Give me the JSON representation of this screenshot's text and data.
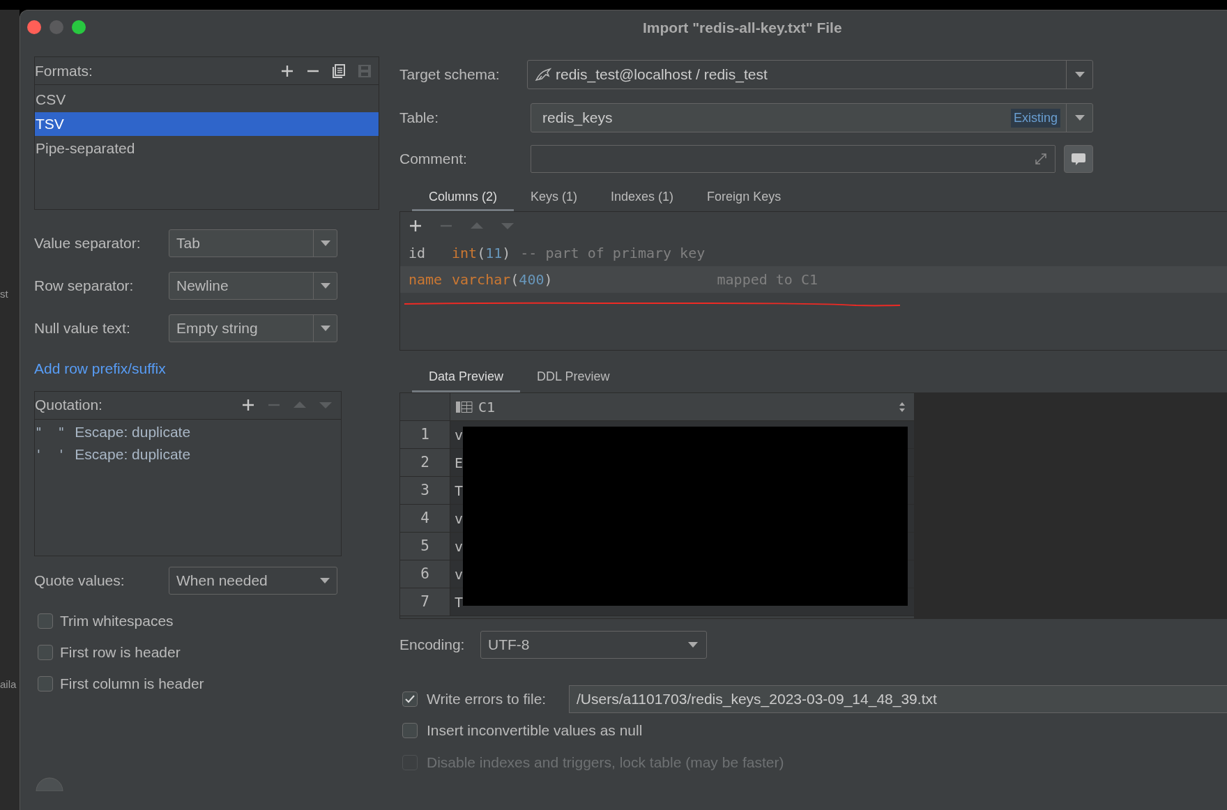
{
  "background_fragments": [
    "st",
    "aila"
  ],
  "window": {
    "title": "Import \"redis-all-key.txt\" File"
  },
  "formats": {
    "label": "Formats:",
    "toolbar": [
      {
        "kind": "add",
        "disabled": false
      },
      {
        "kind": "remove",
        "disabled": false
      },
      {
        "kind": "copy",
        "disabled": false
      },
      {
        "kind": "save",
        "disabled": true
      }
    ],
    "items": [
      {
        "label": "CSV",
        "selected": false
      },
      {
        "label": "TSV",
        "selected": true
      },
      {
        "label": "Pipe-separated",
        "selected": false
      }
    ]
  },
  "separators": [
    {
      "label": "Value separator:",
      "value": "Tab"
    },
    {
      "label": "Row separator:",
      "value": "Newline"
    },
    {
      "label": "Null value text:",
      "value": "Empty string"
    }
  ],
  "add_row_link": "Add row prefix/suffix",
  "quotation": {
    "label": "Quotation:",
    "toolbar": [
      {
        "kind": "add",
        "disabled": false
      },
      {
        "kind": "remove",
        "disabled": true
      },
      {
        "kind": "up",
        "disabled": true
      },
      {
        "kind": "down",
        "disabled": true
      }
    ],
    "items": [
      {
        "quote": "\"  \"",
        "escape": "Escape: duplicate"
      },
      {
        "quote": "'  '",
        "escape": "Escape: duplicate"
      }
    ]
  },
  "quote_values": {
    "label": "Quote values:",
    "value": "When needed"
  },
  "checkboxes": [
    {
      "label": "Trim whitespaces",
      "checked": false
    },
    {
      "label": "First row is header",
      "checked": false
    },
    {
      "label": "First column is header",
      "checked": false
    }
  ],
  "target_schema": {
    "label": "Target schema:",
    "value": "redis_test@localhost / redis_test"
  },
  "table": {
    "label": "Table:",
    "value": "redis_keys",
    "badge": "Existing"
  },
  "comment": {
    "label": "Comment:"
  },
  "column_tabs": [
    {
      "label": "Columns (2)",
      "selected": true
    },
    {
      "label": "Keys (1)",
      "selected": false
    },
    {
      "label": "Indexes (1)",
      "selected": false
    },
    {
      "label": "Foreign Keys",
      "selected": false
    }
  ],
  "columns_toolbar": [
    {
      "kind": "add",
      "disabled": false
    },
    {
      "kind": "remove",
      "disabled": true
    },
    {
      "kind": "up",
      "disabled": true
    },
    {
      "kind": "down",
      "disabled": true
    }
  ],
  "columns": [
    {
      "name": "id",
      "type_parts": [
        "int",
        "(",
        "11",
        ")"
      ],
      "note": "-- part of primary key",
      "mapped": false
    },
    {
      "name": "name",
      "type_parts": [
        "varchar",
        "(",
        "400",
        ")"
      ],
      "note": "mapped to C1",
      "mapped": true
    }
  ],
  "preview_tabs": [
    {
      "label": "Data Preview",
      "selected": true
    },
    {
      "label": "DDL Preview",
      "selected": false
    }
  ],
  "preview": {
    "column": "C1",
    "rows": [
      {
        "number": "1",
        "value": "v"
      },
      {
        "number": "2",
        "value": "E"
      },
      {
        "number": "3",
        "value": "T"
      },
      {
        "number": "4",
        "value": "v"
      },
      {
        "number": "5",
        "value": "v"
      },
      {
        "number": "6",
        "value": "v"
      },
      {
        "number": "7",
        "value": "T"
      }
    ]
  },
  "encoding": {
    "label": "Encoding:",
    "value": "UTF-8"
  },
  "write_errors": {
    "label": "Write errors to file:",
    "checked": true,
    "path": "/Users/a1101703/redis_keys_2023-03-09_14_48_39.txt"
  },
  "options": [
    {
      "label": "Insert inconvertible values as null",
      "checked": false,
      "disabled": false
    },
    {
      "label": "Disable indexes and triggers, lock table (may be faster)",
      "checked": false,
      "disabled": true
    }
  ]
}
